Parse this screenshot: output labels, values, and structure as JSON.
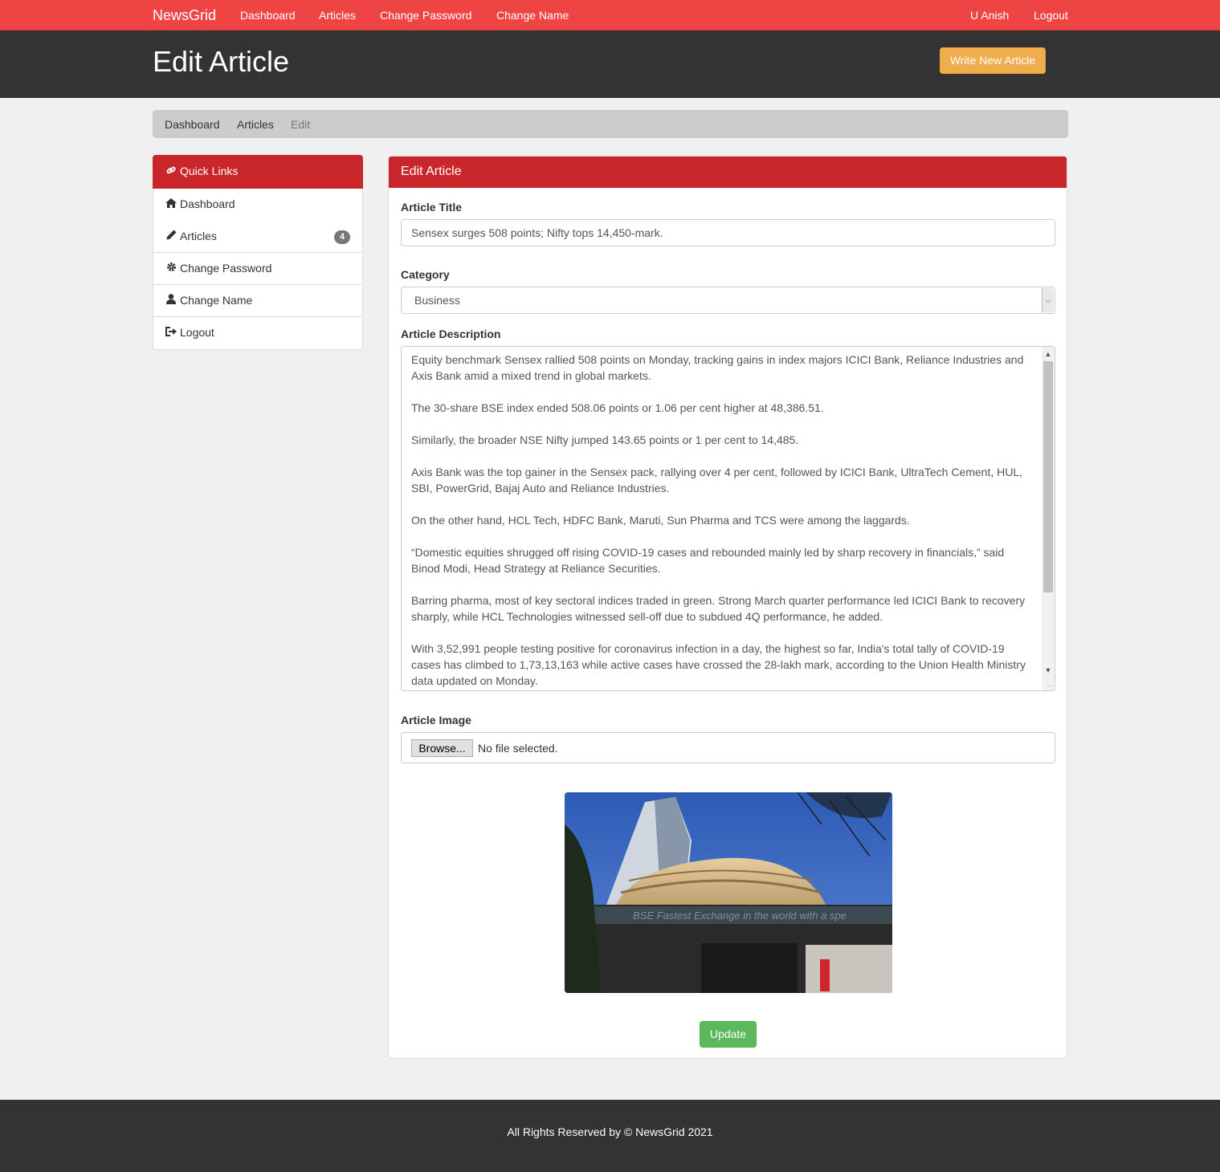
{
  "nav": {
    "brand": "NewsGrid",
    "links": [
      "Dashboard",
      "Articles",
      "Change Password",
      "Change Name"
    ],
    "user": "U Anish",
    "logout": "Logout"
  },
  "header": {
    "title": "Edit Article",
    "write_button": "Write New Article"
  },
  "breadcrumb": [
    "Dashboard",
    "Articles",
    "Edit"
  ],
  "sidebar": {
    "title": "Quick Links",
    "title_icon": "link-icon",
    "items": [
      {
        "label": "Dashboard",
        "icon": "home-icon"
      },
      {
        "label": "Articles",
        "icon": "pencil-icon",
        "badge": "4"
      },
      {
        "label": "Change Password",
        "icon": "gear-icon"
      },
      {
        "label": "Change Name",
        "icon": "user-icon"
      },
      {
        "label": "Logout",
        "icon": "logout-icon"
      }
    ]
  },
  "form": {
    "panel_title": "Edit Article",
    "title_label": "Article Title",
    "title_value": "Sensex surges 508 points; Nifty tops 14,450-mark.",
    "category_label": "Category",
    "category_value": "Business",
    "description_label": "Article Description",
    "description_paragraphs": [
      "Equity benchmark Sensex rallied 508 points on Monday, tracking gains in index majors ICICI Bank, Reliance Industries and Axis Bank amid a mixed trend in global markets.",
      "The 30-share BSE index ended 508.06 points or 1.06 per cent higher at 48,386.51.",
      "Similarly, the broader NSE Nifty jumped 143.65 points or 1 per cent to 14,485.",
      "Axis Bank was the top gainer in the Sensex pack, rallying over 4 per cent, followed by ICICI Bank, UltraTech Cement, HUL, SBI, PowerGrid, Bajaj Auto and Reliance Industries.",
      "On the other hand, HCL Tech, HDFC Bank, Maruti, Sun Pharma and TCS were among the laggards.",
      "“Domestic equities shrugged off rising COVID-19 cases and rebounded mainly led by sharp recovery in financials,” said Binod Modi, Head Strategy at Reliance Securities.",
      "Barring pharma, most of key sectoral indices traded in green. Strong March quarter performance led ICICI Bank to recovery sharply, while HCL Technologies witnessed sell-off due to subdued 4Q performance, he added.",
      "With 3,52,991 people testing positive for coronavirus infection in a day, the highest so far, India's total tally of COVID-19 cases has climbed to 1,73,13,163 while active cases have crossed the 28-lakh mark, according to the Union Health Ministry data updated on Monday."
    ],
    "image_label": "Article Image",
    "browse_label": "Browse...",
    "file_status": "No file selected.",
    "image_ticker": "BSE Fastest Exchange in the world with a spe",
    "update_button": "Update"
  },
  "footer": {
    "text": "All Rights Reserved by © NewsGrid 2021"
  }
}
